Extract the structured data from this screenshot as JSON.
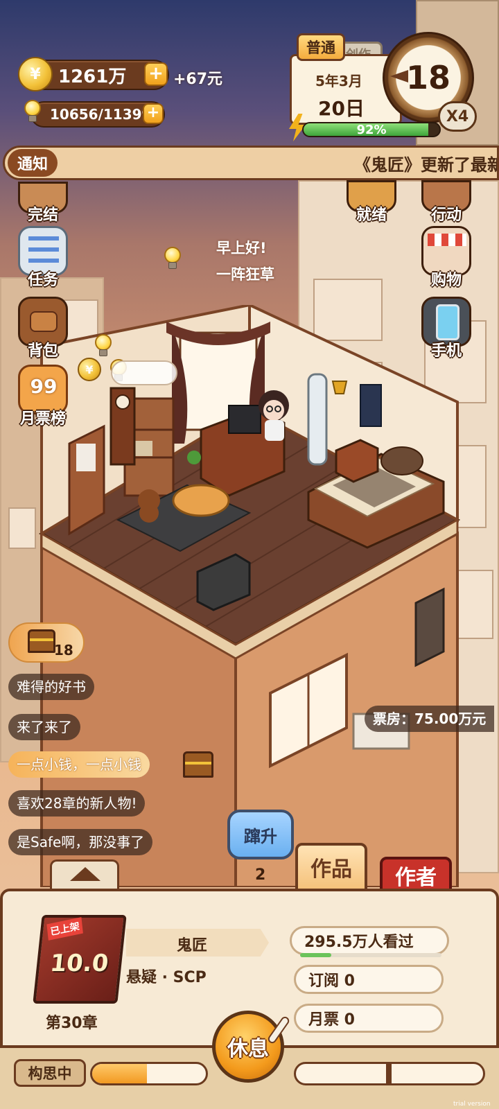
{
  "resources": {
    "coins": "1261万",
    "coin_bonus": "+67元",
    "ideas": "10656/11399",
    "plus": "+"
  },
  "calendar": {
    "mode_tag": "普通",
    "mode_tag_behind": "创作",
    "month": "5年3月",
    "day": "20日",
    "clock_value": "18",
    "speed": "X4",
    "energy_percent": 92,
    "energy_label": "92%"
  },
  "notice": {
    "tag": "通知",
    "text": "《鬼匠》更新了最新"
  },
  "left_menu": [
    {
      "label": "完结",
      "icon": "book-finish-icon"
    },
    {
      "label": "任务",
      "icon": "task-list-icon"
    },
    {
      "label": "背包",
      "icon": "backpack-icon"
    },
    {
      "label": "月票榜",
      "icon": "monthly-ticket-icon"
    }
  ],
  "right_menu": [
    {
      "label": "就绪",
      "icon": "ready-icon"
    },
    {
      "label": "行动",
      "icon": "action-icon"
    },
    {
      "label": "购物",
      "icon": "shop-icon"
    },
    {
      "label": "手机",
      "icon": "phone-icon"
    }
  ],
  "monthly_badge": "99",
  "speech": {
    "line1": "早上好!",
    "line2": "一阵狂草"
  },
  "treasure_count": "18",
  "comments": [
    "难得的好书",
    "来了来了",
    "一点小钱，一点小钱",
    "喜欢28章的新人物!",
    "是Safe啊，那没事了"
  ],
  "box_office": "票房：75.00万元",
  "rise": {
    "label": "蹿升",
    "count": "2"
  },
  "tabs": {
    "works": "作品",
    "author": "作者"
  },
  "book": {
    "shelf_tag": "已上架",
    "score": "10.0",
    "title": "鬼匠",
    "genre": "悬疑 · SCP",
    "chapter": "第30章",
    "views": "295.5万人看过",
    "views_progress": 0.22,
    "subscribe": "订阅 0",
    "monthly_ticket": "月票 0"
  },
  "footer": {
    "status": "构思中",
    "plan_progress": 0.48,
    "rest_label": "休息"
  },
  "watermark": "trial version"
}
